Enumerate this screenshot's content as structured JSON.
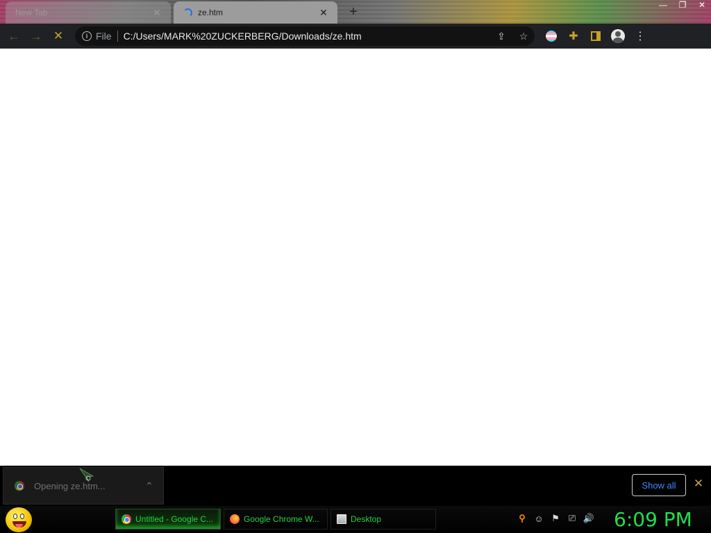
{
  "tabs": [
    {
      "title": "New Tab",
      "active": false
    },
    {
      "title": "ze.htm",
      "active": true
    }
  ],
  "toolbar": {
    "scheme": "File",
    "url": "C:/Users/MARK%20ZUCKERBERG/Downloads/ze.htm"
  },
  "download_shelf": {
    "item_label": "Opening ze.htm...",
    "show_all_label": "Show all"
  },
  "taskbar": {
    "tasks": [
      {
        "label": "Untitled - Google C...",
        "icon": "chrome-icon",
        "active": true
      },
      {
        "label": "Google Chrome W...",
        "icon": "firefox-icon",
        "active": false
      },
      {
        "label": "Desktop",
        "icon": "desktop-icon",
        "active": false
      }
    ],
    "clock": "6:09 PM"
  },
  "colors": {
    "accent_gold": "#c9a227",
    "clock_green": "#1fe04a",
    "task_green": "#22d640",
    "link_blue": "#3d8bff"
  }
}
